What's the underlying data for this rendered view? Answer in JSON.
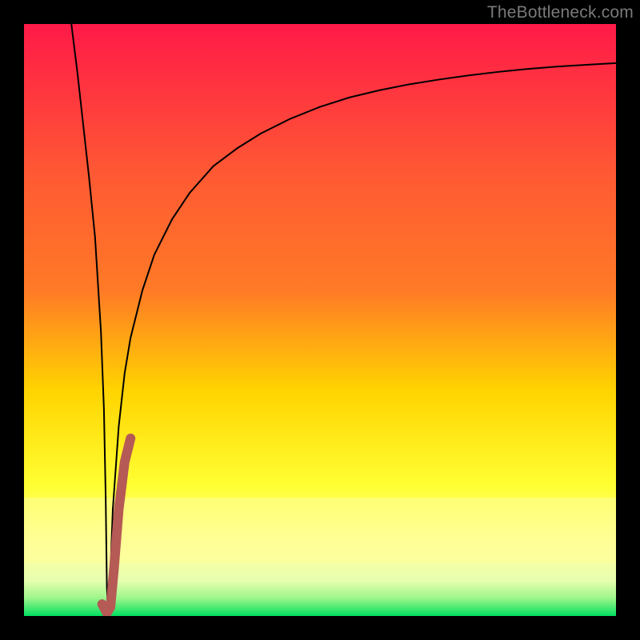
{
  "watermark": "TheBottleneck.com",
  "chart_data": {
    "type": "line",
    "title": "",
    "xlabel": "",
    "ylabel": "",
    "xlim": [
      0,
      100
    ],
    "ylim": [
      0,
      100
    ],
    "background_gradient": {
      "top": "#ff1a48",
      "mid_upper": "#ff7a26",
      "mid": "#ffd400",
      "mid_lower": "#ffff33",
      "band": "#ffff99",
      "bottom": "#00e060"
    },
    "series": [
      {
        "name": "main-curve",
        "color": "#000000",
        "stroke_width": 2,
        "x": [
          8,
          9,
          10,
          11,
          12,
          13,
          13.5,
          13.8,
          14,
          14.2,
          14.5,
          15,
          16,
          17,
          18,
          20,
          22,
          25,
          28,
          32,
          36,
          40,
          45,
          50,
          55,
          60,
          65,
          70,
          75,
          80,
          85,
          90,
          95,
          100
        ],
        "y": [
          100,
          92,
          83,
          74,
          64,
          48,
          35,
          20,
          5,
          0,
          5,
          18,
          32,
          41,
          47,
          55,
          61,
          67,
          71.5,
          76,
          79,
          81.5,
          84,
          86,
          87.6,
          88.8,
          89.8,
          90.6,
          91.3,
          91.9,
          92.4,
          92.8,
          93.1,
          93.4
        ]
      },
      {
        "name": "highlight-segment",
        "color": "#b55a55",
        "stroke_width": 12,
        "linecap": "round",
        "x": [
          13.2,
          14.0,
          14.6,
          15.2,
          16.0,
          17.0,
          18.0
        ],
        "y": [
          2.0,
          0.5,
          1.5,
          8.0,
          18.0,
          26.0,
          30.0
        ]
      }
    ]
  }
}
